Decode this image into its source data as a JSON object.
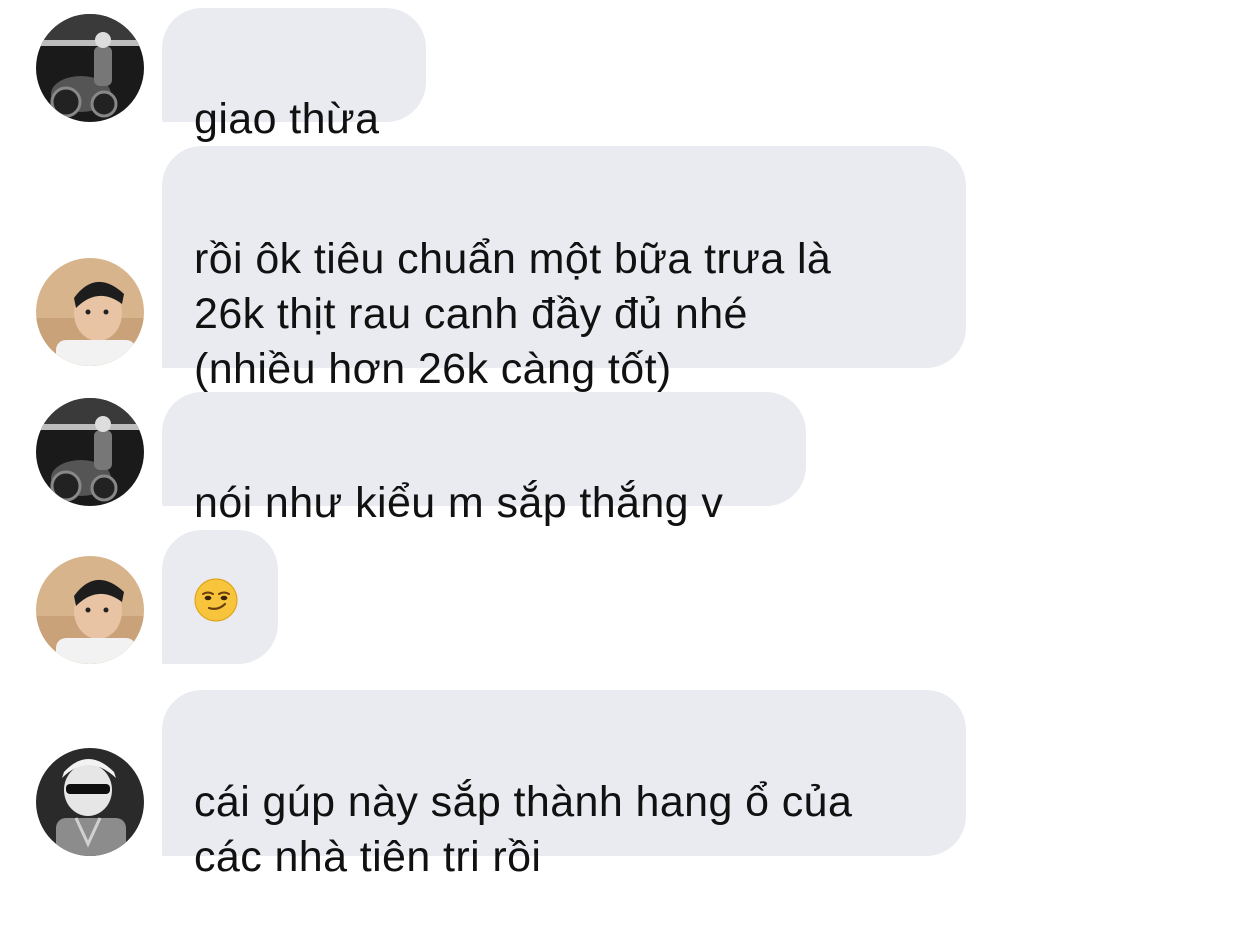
{
  "messages": [
    {
      "sender": "user-a",
      "text": "giao thừa"
    },
    {
      "sender": "user-b",
      "text": "rồi ôk tiêu chuẩn một bữa trưa là\n26k thịt rau canh đầy đủ nhé\n(nhiều hơn 26k càng tốt)"
    },
    {
      "sender": "user-a",
      "text": "nói như kiểu m sắp thắng v"
    },
    {
      "sender": "user-b",
      "emoji": "smirking-face"
    },
    {
      "sender": "user-c",
      "text": "cái gúp này sắp thành hang ổ của\ncác nhà tiên tri rồi"
    }
  ],
  "colors": {
    "bubble_bg": "#e9ebf0",
    "text": "#111111",
    "background": "#ffffff"
  }
}
